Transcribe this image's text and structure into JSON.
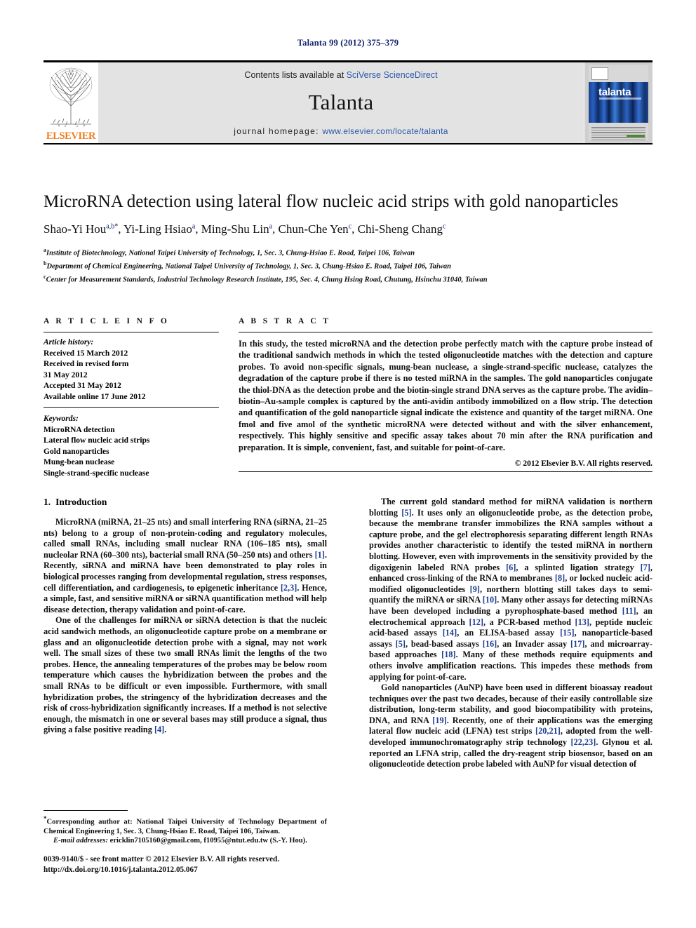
{
  "running_head": "Talanta 99 (2012) 375–379",
  "masthead": {
    "contents_prefix": "Contents lists available at ",
    "sciencedirect_link": "SciVerse ScienceDirect",
    "journal_name": "Talanta",
    "homepage_label": "journal homepage: ",
    "homepage_url": "www.elsevier.com/locate/talanta",
    "publisher_wordmark": "ELSEVIER",
    "cover_title": "talanta"
  },
  "article": {
    "title": "MicroRNA detection using lateral flow nucleic acid strips with gold nanoparticles",
    "authors": [
      {
        "name": "Shao-Yi Hou",
        "sup": "a,b",
        "star": "*"
      },
      {
        "name": "Yi-Ling Hsiao",
        "sup": "a",
        "star": ""
      },
      {
        "name": "Ming-Shu Lin",
        "sup": "a",
        "star": ""
      },
      {
        "name": "Chun-Che Yen",
        "sup": "c",
        "star": ""
      },
      {
        "name": "Chi-Sheng Chang",
        "sup": "c",
        "star": ""
      }
    ],
    "affiliations": [
      {
        "mark": "a",
        "text": "Institute of Biotechnology, National Taipei University of Technology, 1, Sec. 3, Chung-Hsiao E. Road, Taipei 106, Taiwan"
      },
      {
        "mark": "b",
        "text": "Department of Chemical Engineering, National Taipei University of Technology, 1, Sec. 3, Chung-Hsiao E. Road, Taipei 106, Taiwan"
      },
      {
        "mark": "c",
        "text": "Center for Measurement Standards, Industrial Technology Research Institute, 195, Sec. 4, Chung Hsing Road, Chutung, Hsinchu 31040, Taiwan"
      }
    ]
  },
  "article_info": {
    "heading": "A R T I C L E  I N F O",
    "history_heading": "Article history:",
    "history": [
      "Received 15 March 2012",
      "Received in revised form",
      "31 May 2012",
      "Accepted 31 May 2012",
      "Available online 17 June 2012"
    ],
    "keywords_heading": "Keywords:",
    "keywords": [
      "MicroRNA detection",
      "Lateral flow nucleic acid strips",
      "Gold nanoparticles",
      "Mung-bean nuclease",
      "Single-strand-specific nuclease"
    ]
  },
  "abstract": {
    "heading": "A B S T R A C T",
    "text": "In this study, the tested microRNA and the detection probe perfectly match with the capture probe instead of the traditional sandwich methods in which the tested oligonucleotide matches with the detection and capture probes. To avoid non-specific signals, mung-bean nuclease, a single-strand-specific nuclease, catalyzes the degradation of the capture probe if there is no tested miRNA in the samples. The gold nanoparticles conjugate the thiol-DNA as the detection probe and the biotin-single strand DNA serves as the capture probe. The avidin–biotin–Au-sample complex is captured by the anti-avidin antibody immobilized on a flow strip. The detection and quantification of the gold nanoparticle signal indicate the existence and quantity of the target miRNA. One fmol and five amol of the synthetic microRNA were detected without and with the silver enhancement, respectively. This highly sensitive and specific assay takes about 70 min after the RNA purification and preparation. It is simple, convenient, fast, and suitable for point-of-care.",
    "copyright": "© 2012 Elsevier B.V. All rights reserved."
  },
  "body": {
    "section_number": "1.",
    "section_title": "Introduction",
    "left_paragraphs": [
      "MicroRNA (miRNA, 21–25 nts) and small interfering RNA (siRNA, 21–25 nts) belong to a group of non-protein-coding and regulatory molecules, called small RNAs, including small nuclear RNA (106–185 nts), small nucleolar RNA (60–300 nts), bacterial small RNA (50–250 nts) and others [1]. Recently, siRNA and miRNA have been demonstrated to play roles in biological processes ranging from developmental regulation, stress responses, cell differentiation, and cardiogenesis, to epigenetic inheritance [2,3]. Hence, a simple, fast, and sensitive miRNA or siRNA quantification method will help disease detection, therapy validation and point-of-care.",
      "One of the challenges for miRNA or siRNA detection is that the nucleic acid sandwich methods, an oligonucleotide capture probe on a membrane or glass and an oligonucleotide detection probe with a signal, may not work well. The small sizes of these two small RNAs limit the lengths of the two probes. Hence, the annealing temperatures of the probes may be below room temperature which causes the hybridization between the probes and the small RNAs to be difficult or even impossible. Furthermore, with small hybridization probes, the stringency of the hybridization decreases and the risk of cross-hybridization significantly increases. If a method is not selective enough, the mismatch in one or several bases may still produce a signal, thus giving a false positive reading [4]."
    ],
    "right_paragraphs": [
      "The current gold standard method for miRNA validation is northern blotting [5]. It uses only an oligonucleotide probe, as the detection probe, because the membrane transfer immobilizes the RNA samples without a capture probe, and the gel electrophoresis separating different length RNAs provides another characteristic to identify the tested miRNA in northern blotting. However, even with improvements in the sensitivity provided by the digoxigenin labeled RNA probes [6], a splinted ligation strategy [7], enhanced cross-linking of the RNA to membranes [8], or locked nucleic acid-modified oligonucleotides [9], northern blotting still takes days to semi-quantify the miRNA or siRNA [10]. Many other assays for detecting miRNAs have been developed including a pyrophosphate-based method [11], an electrochemical approach [12], a PCR-based method [13], peptide nucleic acid-based assays [14], an ELISA-based assay [15], nanoparticle-based assays [5], bead-based assays [16], an Invader assay [17], and microarray-based approaches [18]. Many of these methods require equipments and others involve amplification reactions. This impedes these methods from applying for point-of-care.",
      "Gold nanoparticles (AuNP) have been used in different bioassay readout techniques over the past two decades, because of their easily controllable size distribution, long-term stability, and good biocompatibility with proteins, DNA, and RNA [19]. Recently, one of their applications was the emerging lateral flow nucleic acid (LFNA) test strips [20,21], adopted from the well-developed immunochromatography strip technology [22,23]. Glynou et al. reported an LFNA strip, called the dry-reagent strip biosensor, based on an oligonucleotide detection probe labeled with AuNP for visual detection of"
    ]
  },
  "footnote": {
    "star": "*",
    "corresponding": "Corresponding author at: National Taipei University of Technology Department of Chemical Engineering 1, Sec. 3, Chung-Hsiao E. Road, Taipei 106, Taiwan.",
    "email_label": "E-mail addresses:",
    "emails": "ericklin7105160@gmail.com, f10955@ntut.edu.tw (S.-Y. Hou)."
  },
  "page_footer": {
    "issn_line": "0039-9140/$ - see front matter © 2012 Elsevier B.V. All rights reserved.",
    "doi_line": "http://dx.doi.org/10.1016/j.talanta.2012.05.067"
  },
  "colors": {
    "link_blue": "#2b58a8",
    "citation_blue": "#1b3d8f",
    "running_head_navy": "#11216b",
    "elsevier_orange": "#ef7d21",
    "masthead_gray": "#e3e3e3"
  }
}
